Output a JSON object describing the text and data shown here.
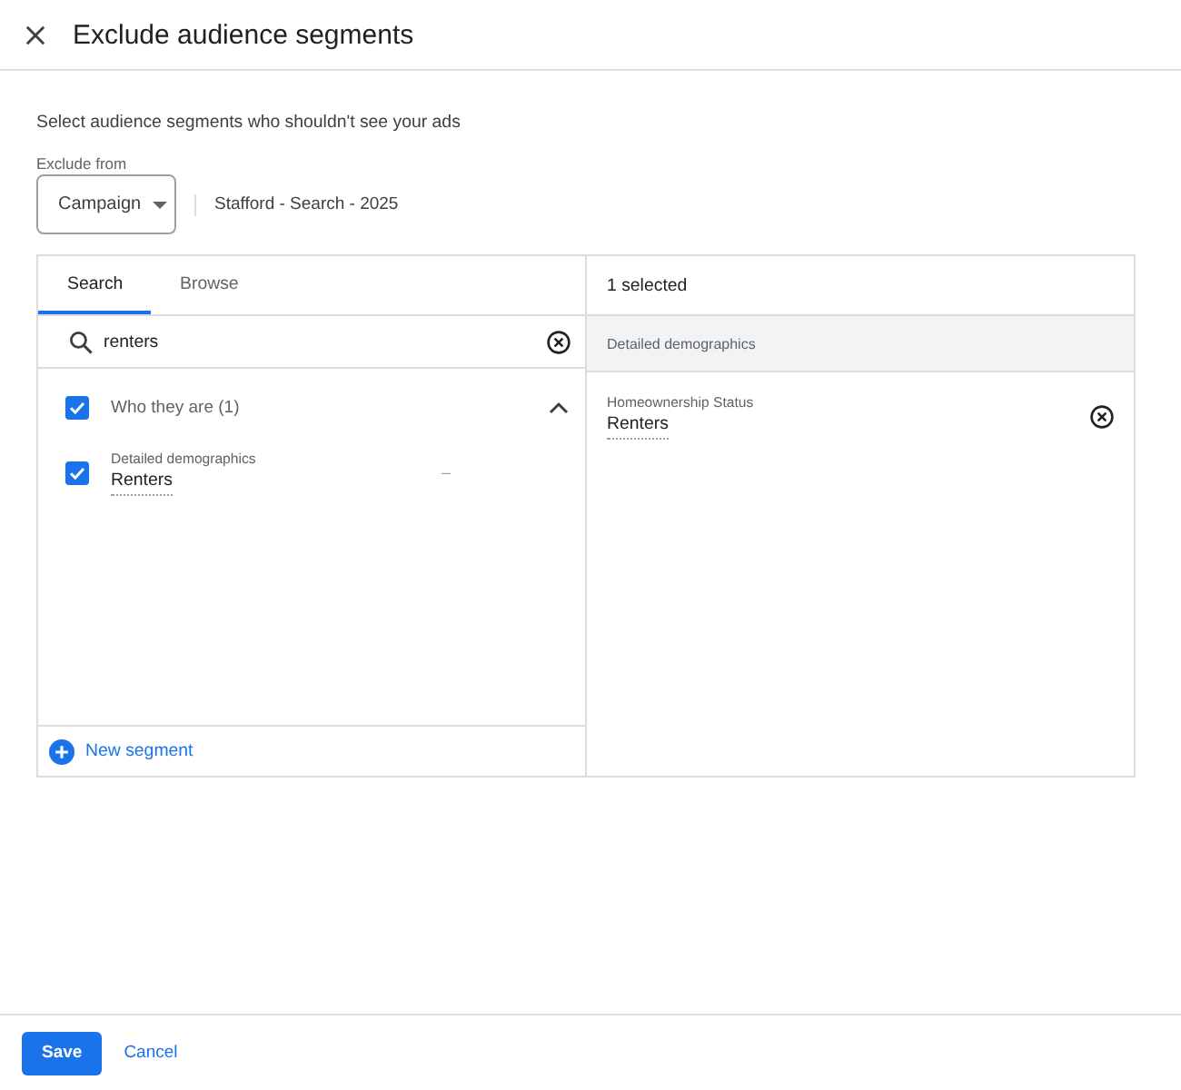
{
  "header": {
    "title": "Exclude audience segments"
  },
  "intro": "Select audience segments who shouldn't see your ads",
  "exclude_from": {
    "label": "Exclude from",
    "value": "Campaign",
    "campaign": "Stafford - Search - 2025"
  },
  "tabs": [
    {
      "label": "Search",
      "selected": true
    },
    {
      "label": "Browse",
      "selected": false
    }
  ],
  "search": {
    "value": "renters"
  },
  "results": [
    {
      "label": "Who they are (1)",
      "checked": true,
      "expanded": true,
      "children": [
        {
          "category": "Detailed demographics",
          "label": "Renters",
          "checked": true,
          "value": "–"
        }
      ]
    }
  ],
  "new_segment": "New segment",
  "selected_panel": {
    "count": "1 selected",
    "groups": [
      {
        "title": "Detailed demographics",
        "items": [
          {
            "category": "Homeownership Status",
            "label": "Renters"
          }
        ]
      }
    ]
  },
  "buttons": [
    {
      "label": "Save",
      "kind": "primary"
    },
    {
      "label": "Cancel",
      "kind": "text"
    }
  ]
}
